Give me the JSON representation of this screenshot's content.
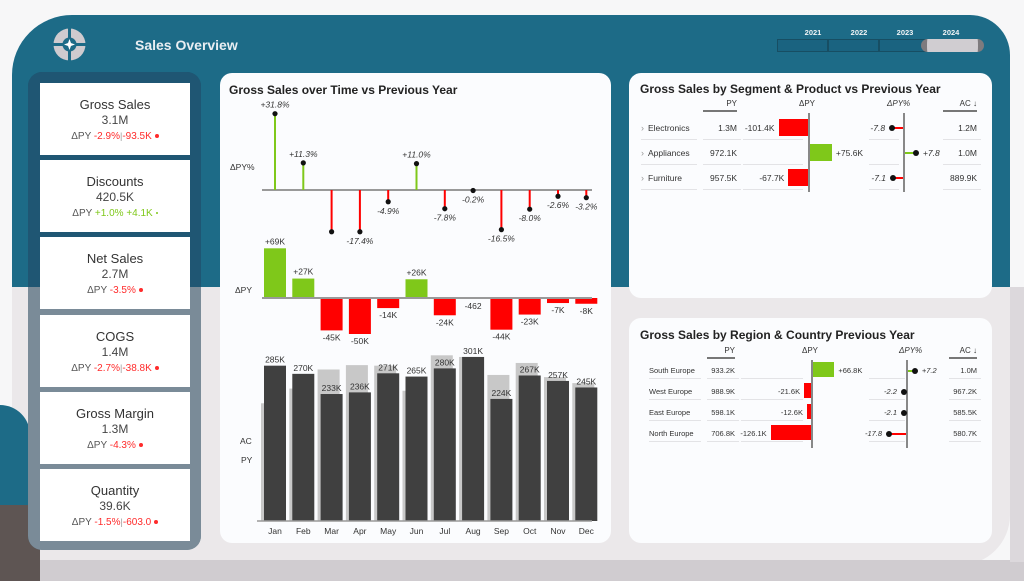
{
  "header": {
    "title": "Sales Overview",
    "logo_icon": "compass-star-icon"
  },
  "year_slicer": {
    "options": [
      "2021",
      "2022",
      "2023",
      "2024"
    ],
    "selected": "2024"
  },
  "colors": {
    "brand": "#1d6b87",
    "positive": "#7fc81a",
    "negative": "#ff0000",
    "ac_bar": "#404040",
    "py_bar": "#c8c8c8"
  },
  "kpis": [
    {
      "name": "Gross Sales",
      "value": "3.1M",
      "delta_label": "ΔPY",
      "delta_pct": "-2.9%",
      "delta_abs": "-93.5K",
      "trend": "neg"
    },
    {
      "name": "Discounts",
      "value": "420.5K",
      "delta_label": "ΔPY",
      "delta_pct": "+1.0%",
      "delta_abs": "+4.1K",
      "trend": "pos"
    },
    {
      "name": "Net Sales",
      "value": "2.7M",
      "delta_label": "ΔPY",
      "delta_pct": "-3.5%",
      "delta_abs": "",
      "trend": "neg"
    },
    {
      "name": "COGS",
      "value": "1.4M",
      "delta_label": "ΔPY",
      "delta_pct": "-2.7%",
      "delta_abs": "-38.8K",
      "trend": "neg"
    },
    {
      "name": "Gross Margin",
      "value": "1.3M",
      "delta_label": "ΔPY",
      "delta_pct": "-4.3%",
      "delta_abs": "",
      "trend": "neg"
    },
    {
      "name": "Quantity",
      "value": "39.6K",
      "delta_label": "ΔPY",
      "delta_pct": "-1.5%",
      "delta_abs": "-603.0",
      "trend": "neg"
    }
  ],
  "time_chart": {
    "title": "Gross Sales over Time vs Previous Year",
    "row_labels": {
      "pct": "ΔPY%",
      "abs": "ΔPY",
      "ac": "AC",
      "py": "PY"
    }
  },
  "chart_data": {
    "type": "bar",
    "title": "Gross Sales over Time vs Previous Year",
    "categories": [
      "Jan",
      "Feb",
      "Mar",
      "Apr",
      "May",
      "Jun",
      "Jul",
      "Aug",
      "Sep",
      "Oct",
      "Nov",
      "Dec"
    ],
    "series": [
      {
        "name": "AC",
        "values": [
          285,
          270,
          233,
          236,
          271,
          265,
          280,
          301,
          224,
          267,
          257,
          245
        ],
        "labels": [
          "285K",
          "270K",
          "233K",
          "236K",
          "271K",
          "265K",
          "280K",
          "301K",
          "224K",
          "267K",
          "257K",
          "245K"
        ],
        "unit": "K"
      },
      {
        "name": "PY",
        "values": [
          216,
          243,
          278,
          286,
          285,
          239,
          304,
          301,
          268,
          290,
          264,
          253
        ],
        "unit": "K"
      },
      {
        "name": "ΔPY",
        "values": [
          69,
          27,
          -45,
          -50,
          -14,
          26,
          -24,
          -0.462,
          -44,
          -23,
          -7,
          -8
        ],
        "labels": [
          "+69K",
          "+27K",
          "-45K",
          "-50K",
          "-14K",
          "+26K",
          "-24K",
          "-462",
          "-44K",
          "-23K",
          "-7K",
          "-8K"
        ],
        "unit": "K"
      },
      {
        "name": "ΔPY%",
        "values": [
          31.8,
          11.3,
          -17.4,
          -17.4,
          -4.9,
          11.0,
          -7.8,
          -0.2,
          -16.5,
          -8.0,
          -2.6,
          -3.2
        ],
        "labels": [
          "+31.8%",
          "+11.3%",
          "",
          "-17.4%",
          "-4.9%",
          "+11.0%",
          "-7.8%",
          "-0.2%",
          "-16.5%",
          "-8.0%",
          "-2.6%",
          "-3.2%"
        ]
      }
    ],
    "xlabel": "",
    "ylabel": ""
  },
  "segment_table": {
    "title": "Gross Sales by Segment & Product vs Previous Year",
    "columns": {
      "py": "PY",
      "dpy": "ΔPY",
      "dpypct": "ΔPY%",
      "ac": "AC ↓"
    },
    "rows": [
      {
        "name": "Electronics",
        "py": "1.3M",
        "dpy": -101.4,
        "dpy_label": "-101.4K",
        "dpypct": -7.8,
        "dpypct_label": "-7.8",
        "ac": "1.2M"
      },
      {
        "name": "Appliances",
        "py": "972.1K",
        "dpy": 75.6,
        "dpy_label": "+75.6K",
        "dpypct": 7.8,
        "dpypct_label": "+7.8",
        "ac": "1.0M"
      },
      {
        "name": "Furniture",
        "py": "957.5K",
        "dpy": -67.7,
        "dpy_label": "-67.7K",
        "dpypct": -7.1,
        "dpypct_label": "-7.1",
        "ac": "889.9K"
      }
    ]
  },
  "region_table": {
    "title": "Gross Sales by Region & Country Previous Year",
    "columns": {
      "py": "PY",
      "dpy": "ΔPY",
      "dpypct": "ΔPY%",
      "ac": "AC ↓"
    },
    "rows": [
      {
        "name": "South Europe",
        "py": "933.2K",
        "dpy": 66.8,
        "dpy_label": "+66.8K",
        "dpypct": 7.2,
        "dpypct_label": "+7.2",
        "ac": "1.0M"
      },
      {
        "name": "West Europe",
        "py": "988.9K",
        "dpy": -21.6,
        "dpy_label": "-21.6K",
        "dpypct": -2.2,
        "dpypct_label": "-2.2",
        "ac": "967.2K"
      },
      {
        "name": "East Europe",
        "py": "598.1K",
        "dpy": -12.6,
        "dpy_label": "-12.6K",
        "dpypct": -2.1,
        "dpypct_label": "-2.1",
        "ac": "585.5K"
      },
      {
        "name": "North Europe",
        "py": "706.8K",
        "dpy": -126.1,
        "dpy_label": "-126.1K",
        "dpypct": -17.8,
        "dpypct_label": "-17.8",
        "ac": "580.7K"
      }
    ]
  }
}
